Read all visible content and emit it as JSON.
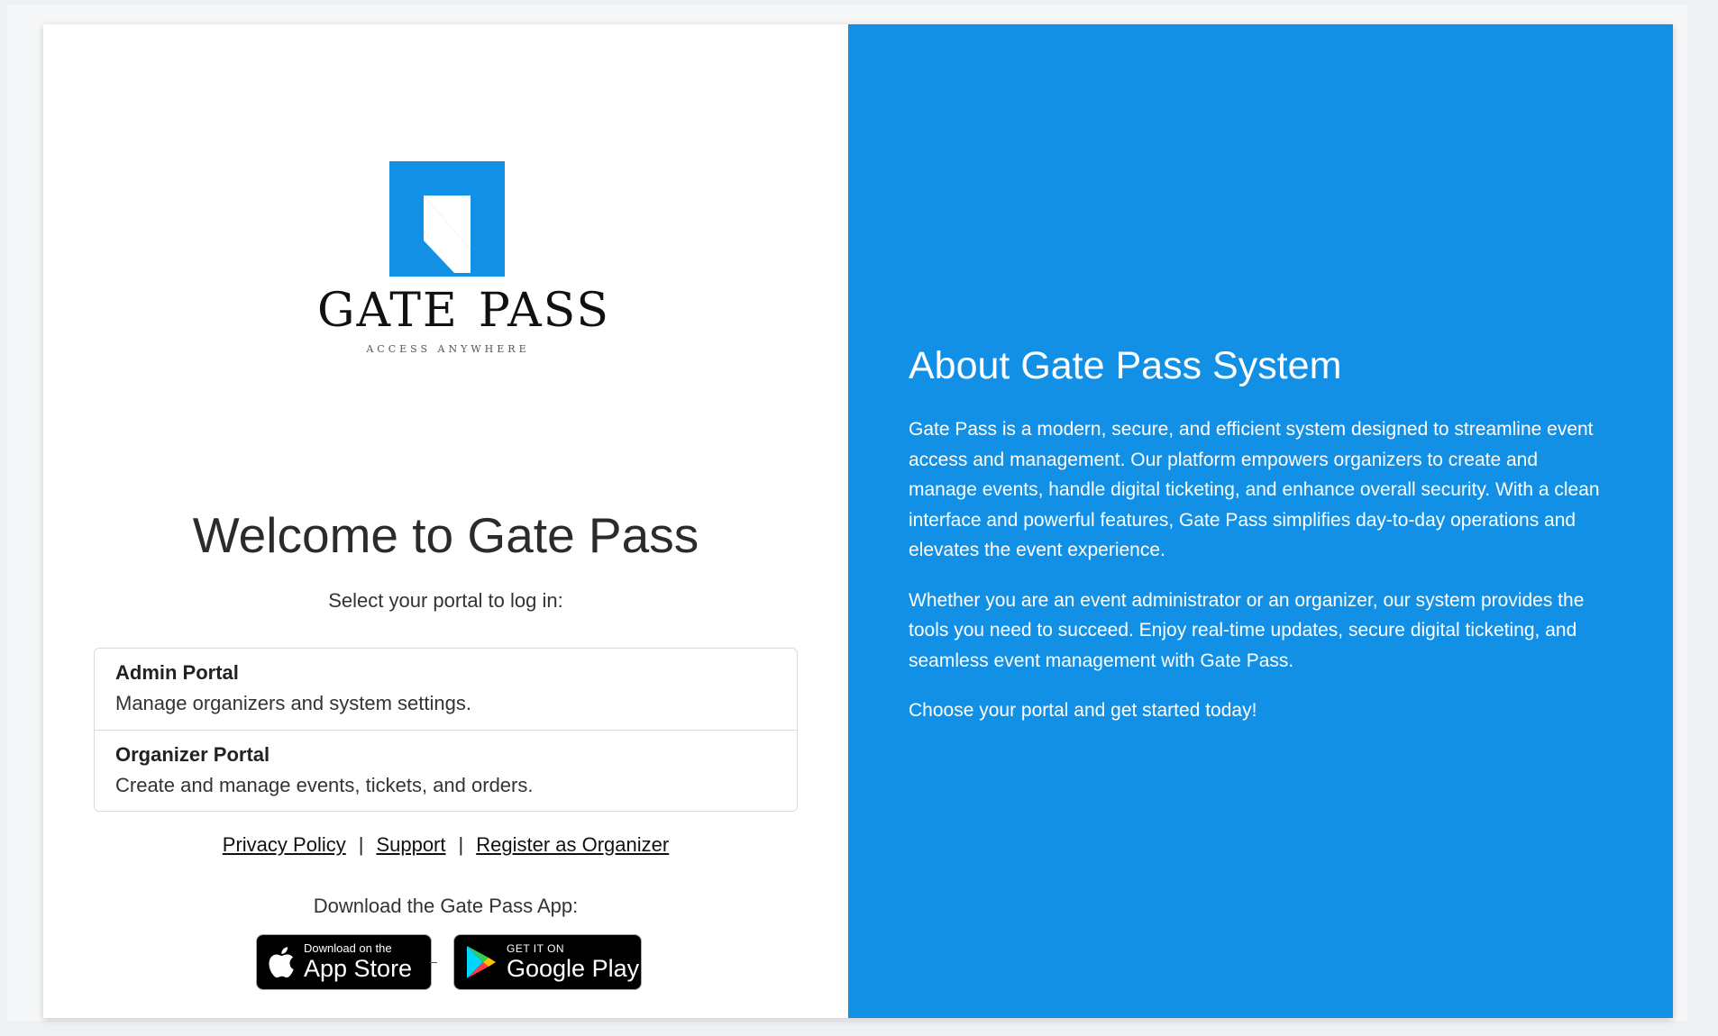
{
  "colors": {
    "accent": "#1190e6",
    "page_bg": "#eef0f2",
    "card_bg": "#ffffff"
  },
  "logo": {
    "wordmark_left": "GATE",
    "wordmark_right": "PASS",
    "tagline": "ACCESS ANYWHERE"
  },
  "welcome": {
    "title": "Welcome to Gate Pass",
    "subtitle": "Select your portal to log in:"
  },
  "portals": [
    {
      "name": "Admin Portal",
      "description": "Manage organizers and system settings."
    },
    {
      "name": "Organizer Portal",
      "description": "Create and manage events, tickets, and orders."
    }
  ],
  "footer_links": {
    "privacy": "Privacy Policy",
    "support": "Support",
    "register": "Register as Organizer",
    "separator": "|"
  },
  "download": {
    "label": "Download the Gate Pass App:",
    "app_store": {
      "small": "Download on the",
      "big": "App Store",
      "icon": "apple-icon"
    },
    "google_play": {
      "small": "GET IT ON",
      "big": "Google Play",
      "icon": "google-play-icon"
    }
  },
  "about": {
    "title": "About Gate Pass System",
    "paragraphs": [
      "Gate Pass is a modern, secure, and efficient system designed to streamline event access and management. Our platform empowers organizers to create and manage events, handle digital ticketing, and enhance overall security. With a clean interface and powerful features, Gate Pass simplifies day-to-day operations and elevates the event experience.",
      "Whether you are an event administrator or an organizer, our system provides the tools you need to succeed. Enjoy real-time updates, secure digital ticketing, and seamless event management with Gate Pass.",
      "Choose your portal and get started today!"
    ]
  }
}
